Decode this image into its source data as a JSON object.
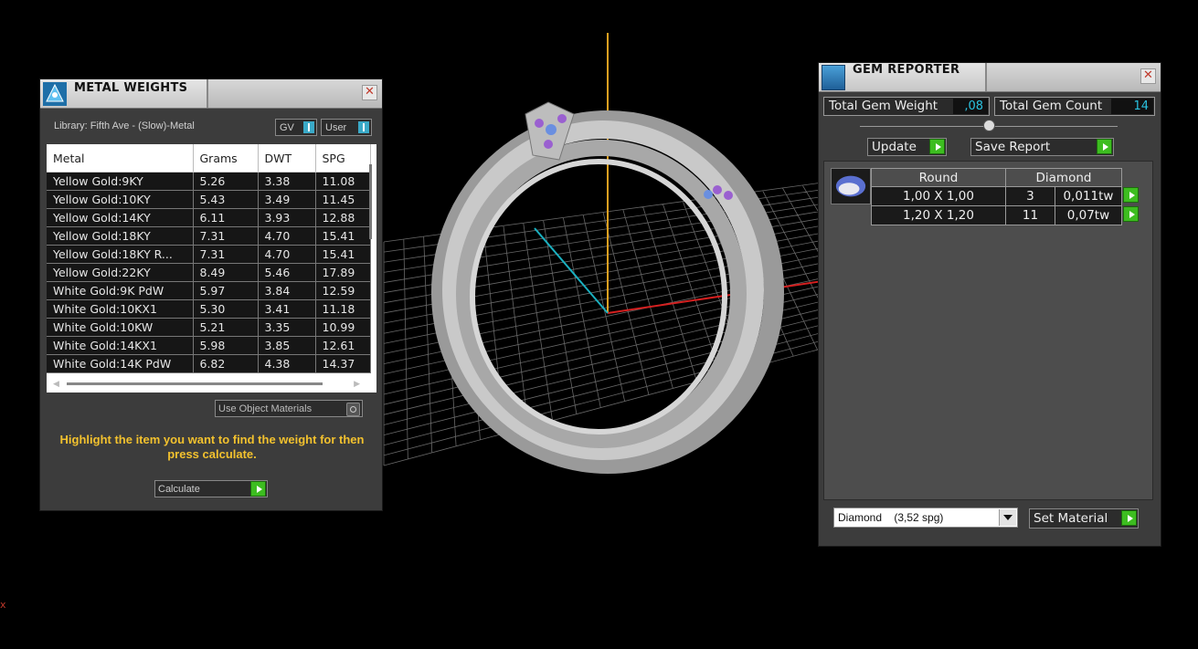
{
  "metal_weights": {
    "title": "METAL WEIGHTS",
    "close": "✕",
    "library": "Library: Fifth Ave - (Slow)-Metal",
    "toggle_gv": "GV",
    "toggle_user": "User",
    "columns": [
      "Metal",
      "Grams",
      "DWT",
      "SPG"
    ],
    "rows": [
      [
        "Yellow Gold:9KY",
        "5.26",
        "3.38",
        "11.08"
      ],
      [
        "Yellow Gold:10KY",
        "5.43",
        "3.49",
        "11.45"
      ],
      [
        "Yellow Gold:14KY",
        "6.11",
        "3.93",
        "12.88"
      ],
      [
        "Yellow Gold:18KY",
        "7.31",
        "4.70",
        "15.41"
      ],
      [
        "Yellow Gold:18KY R...",
        "7.31",
        "4.70",
        "15.41"
      ],
      [
        "Yellow Gold:22KY",
        "8.49",
        "5.46",
        "17.89"
      ],
      [
        "White Gold:9K PdW",
        "5.97",
        "3.84",
        "12.59"
      ],
      [
        "White Gold:10KX1",
        "5.30",
        "3.41",
        "11.18"
      ],
      [
        "White Gold:10KW",
        "5.21",
        "3.35",
        "10.99"
      ],
      [
        "White Gold:14KX1",
        "5.98",
        "3.85",
        "12.61"
      ],
      [
        "White Gold:14K PdW",
        "6.82",
        "4.38",
        "14.37"
      ]
    ],
    "use_object_materials": "Use Object Materials",
    "instruction": "Highlight the item you want to find the weight for then press calculate.",
    "calculate": "Calculate"
  },
  "gem_reporter": {
    "title": "GEM REPORTER",
    "close": "✕",
    "total_gem_weight_label": "Total Gem Weight",
    "total_gem_weight": ",08",
    "total_gem_count_label": "Total Gem Count",
    "total_gem_count": "14",
    "update": "Update",
    "save_report": "Save Report",
    "header": {
      "shape": "Round",
      "material": "Diamond"
    },
    "gems": [
      {
        "size": "1,00 X 1,00",
        "count": "3",
        "weight": "0,011tw"
      },
      {
        "size": "1,20 X 1,20",
        "count": "11",
        "weight": "0,07tw"
      }
    ],
    "material_select": "Diamond    (3,52 spg)",
    "set_material": "Set Material"
  },
  "corner_mark": "x",
  "colors": {
    "accent_cyan": "#2ac2e0",
    "go_green": "#3dbd20",
    "instruction_yellow": "#f2c12e"
  }
}
